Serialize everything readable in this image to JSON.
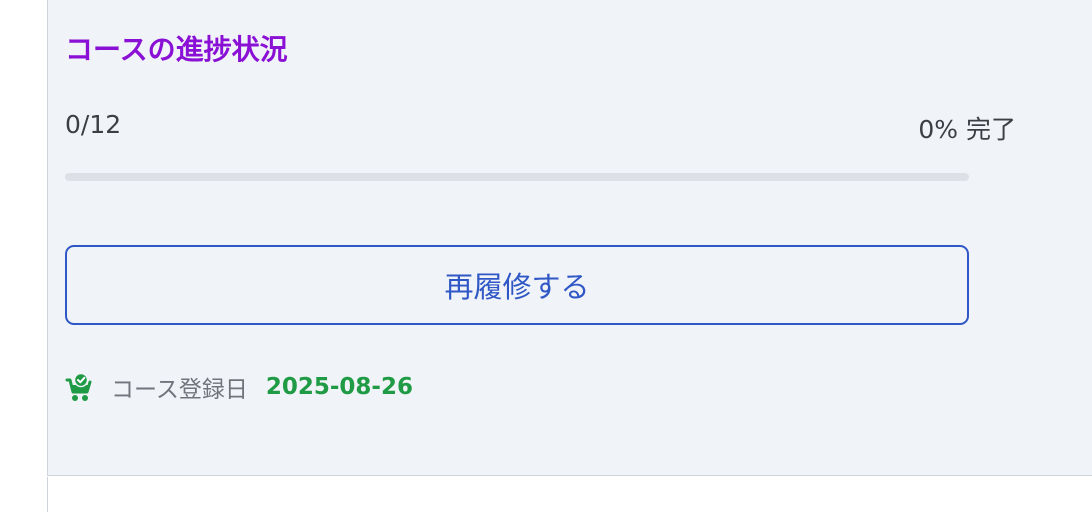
{
  "progress": {
    "title": "コースの進捗状況",
    "completed_count": "0/12",
    "percent_label": "0% 完了",
    "completion_fraction": 0
  },
  "actions": {
    "retake_label": "再履修する"
  },
  "registration": {
    "icon": "cart-check-icon",
    "label": "コース登録日",
    "date": "2025-08-26"
  },
  "colors": {
    "title": "#8a10d6",
    "accent_blue": "#2f57c6",
    "date_green": "#1f9a45",
    "panel_bg": "#f0f3f7"
  }
}
